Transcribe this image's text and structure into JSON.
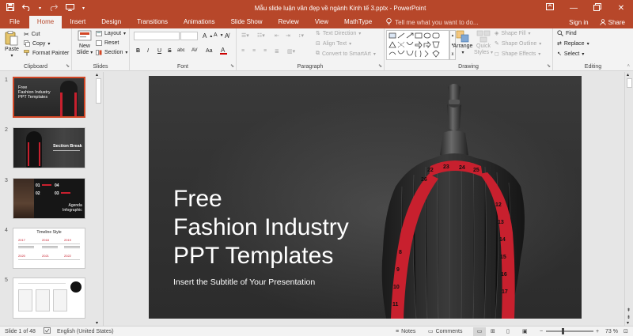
{
  "window": {
    "title": "Mẫu slide luận văn đẹp về ngành Kinh tế 3.pptx - PowerPoint"
  },
  "tabs": [
    "File",
    "Home",
    "Insert",
    "Design",
    "Transitions",
    "Animations",
    "Slide Show",
    "Review",
    "View",
    "MathType"
  ],
  "active_tab": "Home",
  "tell_me": "Tell me what you want to do...",
  "account": {
    "signin": "Sign in",
    "share": "Share"
  },
  "ribbon": {
    "clipboard": {
      "label": "Clipboard",
      "paste": "Paste",
      "cut": "Cut",
      "copy": "Copy",
      "format_painter": "Format Painter"
    },
    "slides": {
      "label": "Slides",
      "new_slide_1": "New",
      "new_slide_2": "Slide",
      "layout": "Layout",
      "reset": "Reset",
      "section": "Section"
    },
    "font": {
      "label": "Font",
      "bold": "B",
      "italic": "I",
      "underline": "U",
      "strike": "S",
      "shadow": "abc",
      "spacing": "AV",
      "case": "Aa"
    },
    "paragraph": {
      "label": "Paragraph",
      "text_direction": "Text Direction",
      "align_text": "Align Text",
      "smartart": "Convert to SmartArt"
    },
    "drawing": {
      "label": "Drawing",
      "arrange": "Arrange",
      "quick_styles_1": "Quick",
      "quick_styles_2": "Styles",
      "shape_fill": "Shape Fill",
      "shape_outline": "Shape Outline",
      "shape_effects": "Shape Effects"
    },
    "editing": {
      "label": "Editing",
      "find": "Find",
      "replace": "Replace",
      "select": "Select"
    }
  },
  "thumbnails": [
    {
      "num": "1",
      "title": "Free Fashion Industry PPT Templates"
    },
    {
      "num": "2",
      "title": "Section Break"
    },
    {
      "num": "3",
      "title": "Agenda Infographic"
    },
    {
      "num": "4",
      "title": "Timeline Style"
    },
    {
      "num": "5",
      "title": ""
    }
  ],
  "thumb_text": {
    "t1_l1": "Free",
    "t1_l2": "Fashion Industry",
    "t1_l3": "PPT Templates",
    "t2": "Section Break",
    "t3_l1": "Agenda",
    "t3_l2": "Infographic",
    "t3_nums": [
      "01",
      "02",
      "03",
      "04"
    ],
    "t4": "Timeline Style",
    "t4_years": [
      "2017",
      "2018",
      "2019",
      "2020",
      "2021",
      "2022"
    ]
  },
  "slide": {
    "title_l1": "Free",
    "title_l2": "Fashion Industry",
    "title_l3": "PPT Templates",
    "subtitle": "Insert the Subtitle of Your Presentation",
    "tape_numbers": [
      "22",
      "23",
      "24",
      "25",
      "26",
      "12",
      "13",
      "14",
      "15",
      "16",
      "17",
      "8",
      "9",
      "10",
      "11"
    ]
  },
  "status": {
    "slide_count": "Slide 1 of 48",
    "language": "English (United States)",
    "notes": "Notes",
    "comments": "Comments",
    "zoom": "73 %",
    "zoom_fraction": 0.73
  },
  "colors": {
    "accent": "#b7472a",
    "ribbon_bg": "#f3f3f3",
    "tape_red": "#c8202e"
  }
}
